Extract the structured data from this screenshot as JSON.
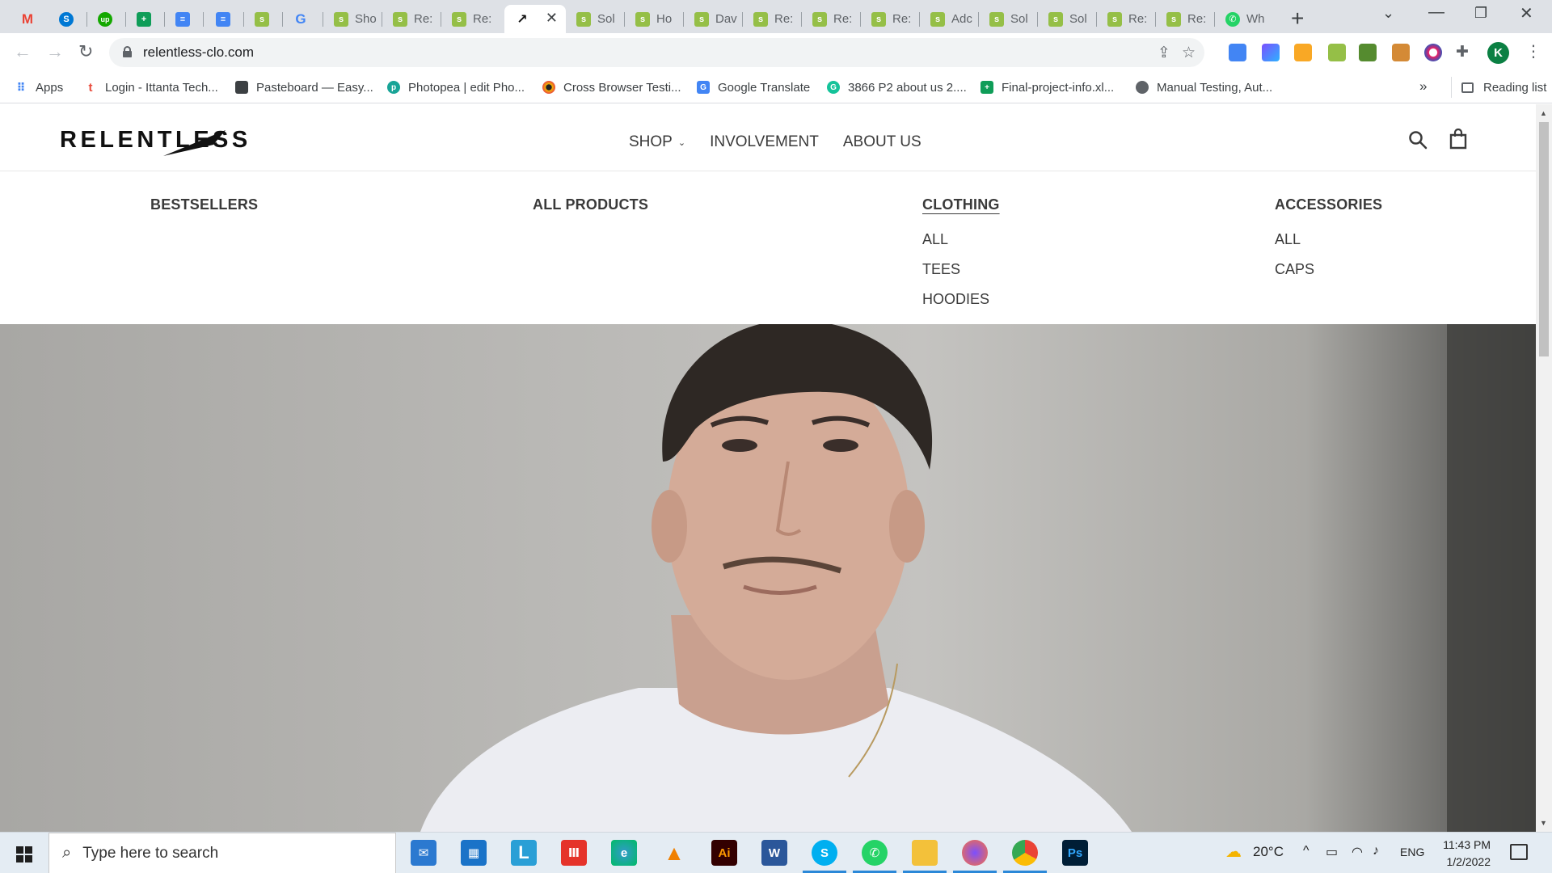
{
  "browser": {
    "tabs": [
      {
        "title": "",
        "icon": "gmail-icon",
        "color": "#ea4335"
      },
      {
        "title": "",
        "icon": "skype-icon",
        "color": "#0078d4"
      },
      {
        "title": "",
        "icon": "upwork-icon",
        "color": "#14a800"
      },
      {
        "title": "",
        "icon": "google-sheets-icon",
        "color": "#0f9d58"
      },
      {
        "title": "",
        "icon": "google-docs-icon",
        "color": "#4285f4"
      },
      {
        "title": "",
        "icon": "google-docs-icon",
        "color": "#4285f4"
      },
      {
        "title": "",
        "icon": "shopify-icon",
        "color": "#95bf47"
      },
      {
        "title": "",
        "icon": "google-icon",
        "color": "#4285f4"
      },
      {
        "title": "Sho",
        "icon": "shopify-icon",
        "color": "#95bf47"
      },
      {
        "title": "Re:",
        "icon": "shopify-icon",
        "color": "#95bf47"
      },
      {
        "title": "Re:",
        "icon": "shopify-icon",
        "color": "#95bf47"
      },
      {
        "title": "",
        "icon": "relentless-icon",
        "color": "#111111",
        "active": true
      },
      {
        "title": "Sol",
        "icon": "shopify-icon",
        "color": "#95bf47"
      },
      {
        "title": "Ho",
        "icon": "shopify-icon",
        "color": "#95bf47"
      },
      {
        "title": "Dav",
        "icon": "shopify-icon",
        "color": "#95bf47"
      },
      {
        "title": "Re:",
        "icon": "shopify-icon",
        "color": "#95bf47"
      },
      {
        "title": "Re:",
        "icon": "shopify-icon",
        "color": "#95bf47"
      },
      {
        "title": "Re:",
        "icon": "shopify-icon",
        "color": "#95bf47"
      },
      {
        "title": "Adc",
        "icon": "shopify-icon",
        "color": "#95bf47"
      },
      {
        "title": "Sol",
        "icon": "shopify-icon",
        "color": "#95bf47"
      },
      {
        "title": "Sol",
        "icon": "shopify-icon",
        "color": "#95bf47"
      },
      {
        "title": "Re:",
        "icon": "shopify-icon",
        "color": "#95bf47"
      },
      {
        "title": "Re:",
        "icon": "shopify-icon",
        "color": "#95bf47"
      },
      {
        "title": "Wh",
        "icon": "whatsapp-icon",
        "color": "#25d366"
      }
    ],
    "url": "relentless-clo.com",
    "profile_initial": "K",
    "bookmarks": [
      {
        "label": "Apps",
        "icon": "apps-grid-icon",
        "color": "#4285f4"
      },
      {
        "label": "Login - Ittanta Tech...",
        "icon": "ittanta-icon",
        "color": "#e94b3c"
      },
      {
        "label": "Pasteboard — Easy...",
        "icon": "pasteboard-icon",
        "color": "#3c4043"
      },
      {
        "label": "Photopea | edit Pho...",
        "icon": "photopea-icon",
        "color": "#18a497"
      },
      {
        "label": "Cross Browser Testi...",
        "icon": "crossbrowser-icon",
        "color": "#f4b400"
      },
      {
        "label": "Google Translate",
        "icon": "google-translate-icon",
        "color": "#4285f4"
      },
      {
        "label": "3866 P2 about us 2....",
        "icon": "grammarly-icon",
        "color": "#15c39a"
      },
      {
        "label": "Final-project-info.xl...",
        "icon": "google-sheets-icon",
        "color": "#0f9d58"
      },
      {
        "label": "Manual Testing, Aut...",
        "icon": "globe-icon",
        "color": "#5f6368"
      }
    ],
    "reading_list": "Reading list"
  },
  "site": {
    "logo": "RELENTLESS",
    "nav": {
      "shop": "SHOP",
      "involvement": "INVOLVEMENT",
      "about": "ABOUT US"
    },
    "megamenu": {
      "bestsellers": "BESTSELLERS",
      "all_products": "ALL PRODUCTS",
      "clothing": {
        "heading": "CLOTHING",
        "items": [
          "ALL",
          "TEES",
          "HOODIES"
        ]
      },
      "accessories": {
        "heading": "ACCESSORIES",
        "items": [
          "ALL",
          "CAPS"
        ]
      }
    }
  },
  "taskbar": {
    "search_placeholder": "Type here to search",
    "temperature": "20°C",
    "language": "ENG",
    "time": "11:43 PM",
    "date": "1/2/2022"
  }
}
